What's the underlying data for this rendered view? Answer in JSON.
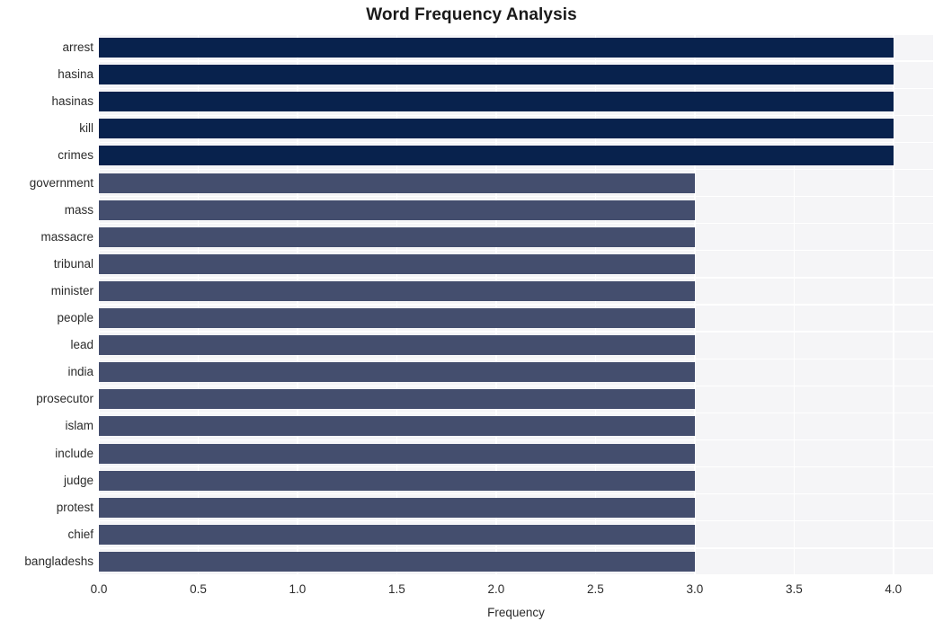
{
  "chart_data": {
    "type": "bar",
    "orientation": "horizontal",
    "title": "Word Frequency Analysis",
    "xlabel": "Frequency",
    "ylabel": "",
    "xlim": [
      0.0,
      4.2
    ],
    "xticks": [
      "0.0",
      "0.5",
      "1.0",
      "1.5",
      "2.0",
      "2.5",
      "3.0",
      "3.5",
      "4.0"
    ],
    "xtick_values": [
      0.0,
      0.5,
      1.0,
      1.5,
      2.0,
      2.5,
      3.0,
      3.5,
      4.0
    ],
    "grid": true,
    "legend": "none",
    "categories": [
      "arrest",
      "hasina",
      "hasinas",
      "kill",
      "crimes",
      "government",
      "mass",
      "massacre",
      "tribunal",
      "minister",
      "people",
      "lead",
      "india",
      "prosecutor",
      "islam",
      "include",
      "judge",
      "protest",
      "chief",
      "bangladeshs"
    ],
    "values": [
      4,
      4,
      4,
      4,
      4,
      3,
      3,
      3,
      3,
      3,
      3,
      3,
      3,
      3,
      3,
      3,
      3,
      3,
      3,
      3
    ],
    "bar_colors": [
      "#08224d",
      "#08224d",
      "#08224d",
      "#08224d",
      "#08224d",
      "#444e6e",
      "#444e6e",
      "#444e6e",
      "#444e6e",
      "#444e6e",
      "#444e6e",
      "#444e6e",
      "#444e6e",
      "#444e6e",
      "#444e6e",
      "#444e6e",
      "#444e6e",
      "#444e6e",
      "#444e6e",
      "#444e6e"
    ]
  },
  "style": {
    "plot_background": "#f5f5f7",
    "figure_background": "#ffffff",
    "gridline_color": "#ffffff",
    "text_color": "#2b2b2b",
    "title_color": "#1a1a1a",
    "color_high": "#08224d",
    "color_low": "#444e6e"
  }
}
